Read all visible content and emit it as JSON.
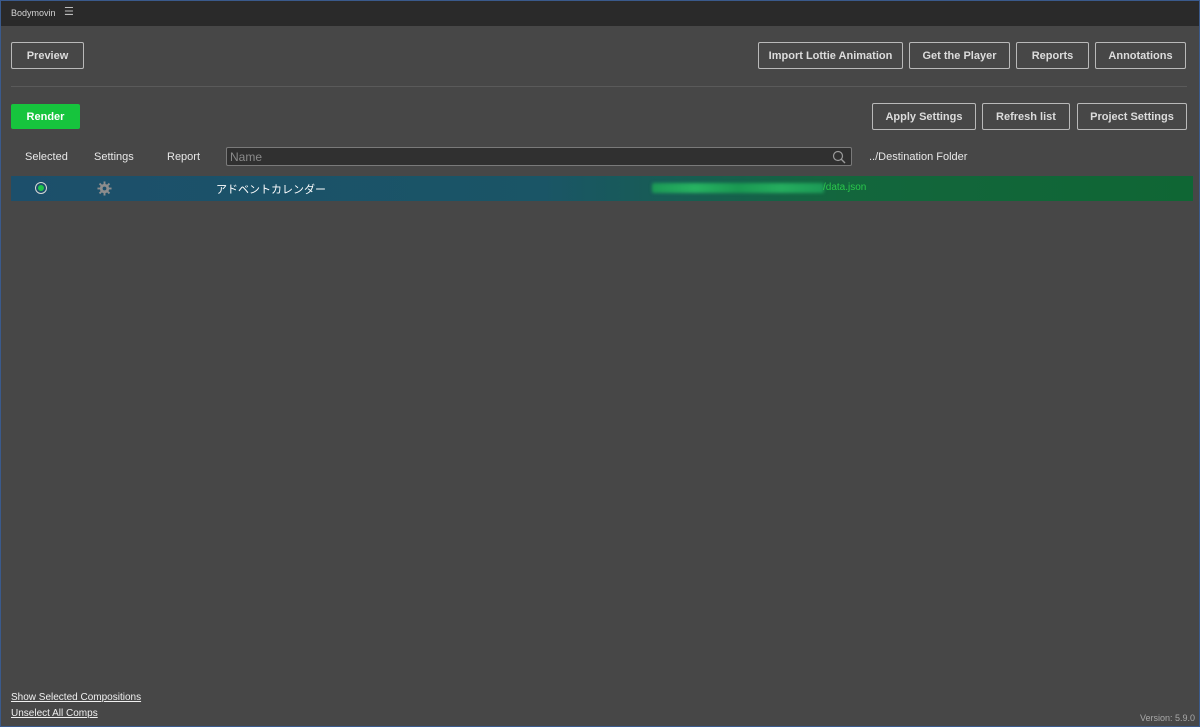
{
  "app": {
    "title": "Bodymovin",
    "menu_icon": "hamburger-menu-icon"
  },
  "toolbar": {
    "preview_label": "Preview",
    "import_lottie_label": "Import Lottie Animation",
    "get_player_label": "Get the Player",
    "reports_label": "Reports",
    "annotations_label": "Annotations"
  },
  "actions": {
    "render_label": "Render",
    "apply_settings_label": "Apply Settings",
    "refresh_list_label": "Refresh list",
    "project_settings_label": "Project Settings"
  },
  "columns": {
    "selected": "Selected",
    "settings": "Settings",
    "report": "Report",
    "destination": "../Destination Folder"
  },
  "search": {
    "placeholder": "Name",
    "value": "",
    "icon": "search-icon"
  },
  "compositions": [
    {
      "selected": true,
      "settings_icon": "gear-icon",
      "name": "アドベントカレンダー",
      "destination_suffix": "/data.json"
    }
  ],
  "footer": {
    "show_selected_label": "Show Selected Compositions",
    "unselect_all_label": "Unselect All Comps",
    "version": "Version: 5.9.0"
  },
  "colors": {
    "accent_green": "#16c43d",
    "background": "#474747",
    "titlebar": "#2a2a2a"
  }
}
